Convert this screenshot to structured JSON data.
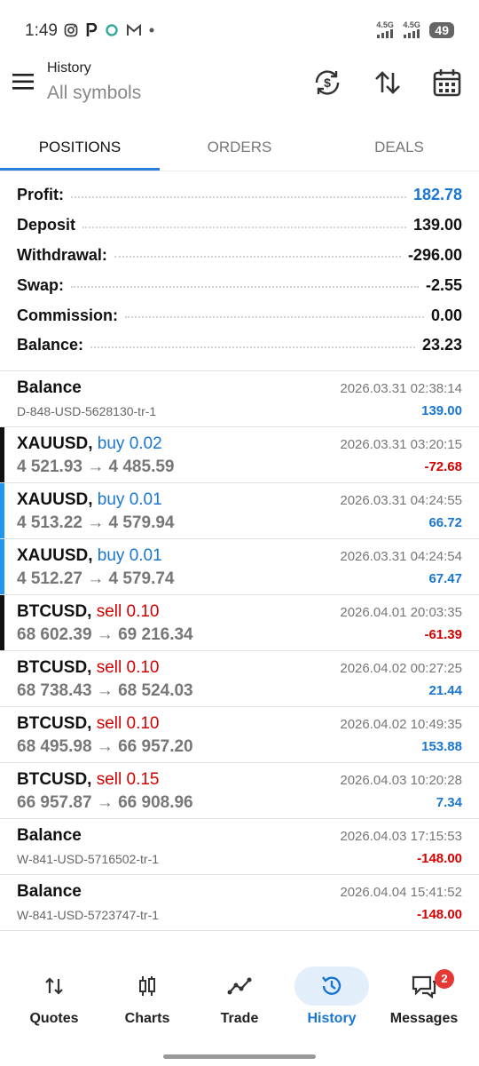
{
  "status_bar": {
    "time": "1:49",
    "signal_1": "4.5G",
    "signal_2": "4.5G",
    "battery": "49"
  },
  "header": {
    "title": "History",
    "subtitle": "All symbols"
  },
  "tabs": [
    {
      "label": "POSITIONS",
      "active": true
    },
    {
      "label": "ORDERS",
      "active": false
    },
    {
      "label": "DEALS",
      "active": false
    }
  ],
  "summary": [
    {
      "label": "Profit:",
      "value": "182.78",
      "color": "#1976d2"
    },
    {
      "label": "Deposit",
      "value": "139.00",
      "color": "#111111"
    },
    {
      "label": "Withdrawal:",
      "value": "-296.00",
      "color": "#111111"
    },
    {
      "label": "Swap:",
      "value": "-2.55",
      "color": "#111111"
    },
    {
      "label": "Commission:",
      "value": "0.00",
      "color": "#111111"
    },
    {
      "label": "Balance:",
      "value": "23.23",
      "color": "#111111"
    }
  ],
  "items": [
    {
      "kind": "balance",
      "symbol": "Balance",
      "sub": "D-848-USD-5628130-tr-1",
      "date": "2026.03.31 02:38:14",
      "amount": "139.00",
      "amount_color": "blue",
      "bar": ""
    },
    {
      "kind": "trade",
      "symbol": "XAUUSD,",
      "direction": "buy 0.02",
      "dir": "buy",
      "sub": "4 521.93 → 4 485.59",
      "date": "2026.03.31 03:20:15",
      "amount": "-72.68",
      "amount_color": "red",
      "bar": "black"
    },
    {
      "kind": "trade",
      "symbol": "XAUUSD,",
      "direction": "buy 0.01",
      "dir": "buy",
      "sub": "4 513.22 → 4 579.94",
      "date": "2026.03.31 04:24:55",
      "amount": "66.72",
      "amount_color": "blue",
      "bar": "blue"
    },
    {
      "kind": "trade",
      "symbol": "XAUUSD,",
      "direction": "buy 0.01",
      "dir": "buy",
      "sub": "4 512.27 → 4 579.74",
      "date": "2026.03.31 04:24:54",
      "amount": "67.47",
      "amount_color": "blue",
      "bar": "blue"
    },
    {
      "kind": "trade",
      "symbol": "BTCUSD,",
      "direction": "sell 0.10",
      "dir": "sell",
      "sub": "68 602.39 → 69 216.34",
      "date": "2026.04.01 20:03:35",
      "amount": "-61.39",
      "amount_color": "red",
      "bar": "black"
    },
    {
      "kind": "trade",
      "symbol": "BTCUSD,",
      "direction": "sell 0.10",
      "dir": "sell",
      "sub": "68 738.43 → 68 524.03",
      "date": "2026.04.02 00:27:25",
      "amount": "21.44",
      "amount_color": "blue",
      "bar": ""
    },
    {
      "kind": "trade",
      "symbol": "BTCUSD,",
      "direction": "sell 0.10",
      "dir": "sell",
      "sub": "68 495.98 → 66 957.20",
      "date": "2026.04.02 10:49:35",
      "amount": "153.88",
      "amount_color": "blue",
      "bar": ""
    },
    {
      "kind": "trade",
      "symbol": "BTCUSD,",
      "direction": "sell 0.15",
      "dir": "sell",
      "sub": "66 957.87 → 66 908.96",
      "date": "2026.04.03 10:20:28",
      "amount": "7.34",
      "amount_color": "blue",
      "bar": ""
    },
    {
      "kind": "balance",
      "symbol": "Balance",
      "sub": "W-841-USD-5716502-tr-1",
      "date": "2026.04.03 17:15:53",
      "amount": "-148.00",
      "amount_color": "red",
      "bar": ""
    },
    {
      "kind": "balance",
      "symbol": "Balance",
      "sub": "W-841-USD-5723747-tr-1",
      "date": "2026.04.04 15:41:52",
      "amount": "-148.00",
      "amount_color": "red",
      "bar": ""
    }
  ],
  "bottom_nav": [
    {
      "label": "Quotes",
      "icon": "quotes-icon",
      "active": false
    },
    {
      "label": "Charts",
      "icon": "charts-icon",
      "active": false
    },
    {
      "label": "Trade",
      "icon": "trade-icon",
      "active": false
    },
    {
      "label": "History",
      "icon": "history-icon",
      "active": true
    },
    {
      "label": "Messages",
      "icon": "messages-icon",
      "active": false,
      "badge": "2"
    }
  ]
}
